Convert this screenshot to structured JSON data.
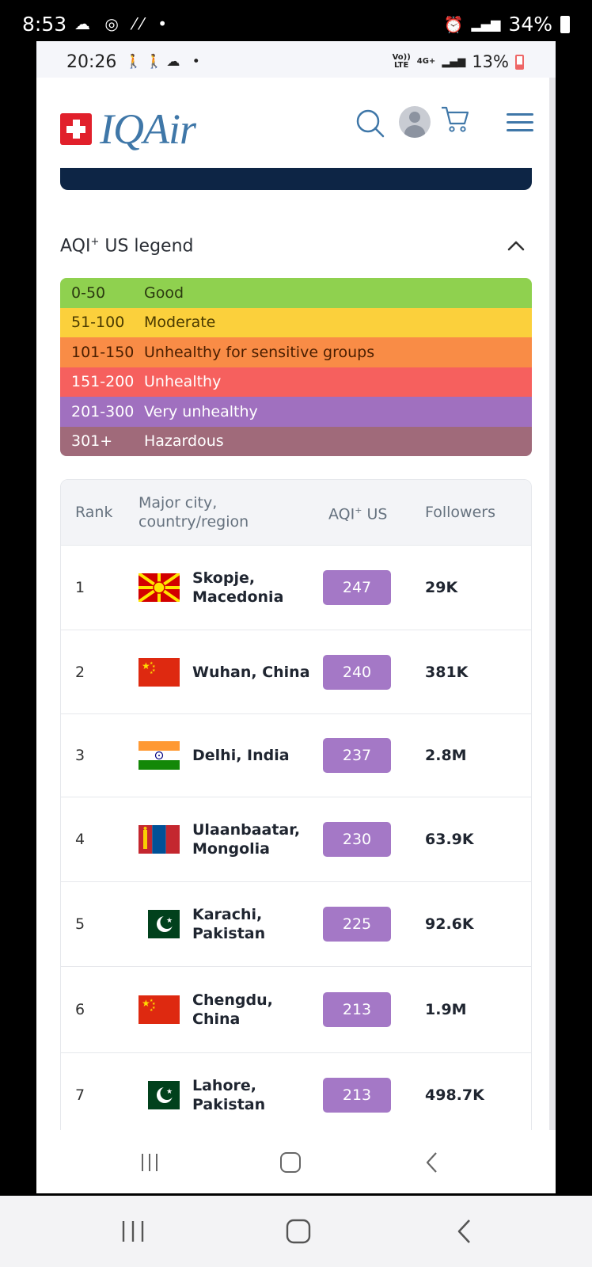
{
  "outer_status": {
    "time": "8:53",
    "battery": "34%"
  },
  "inner_status": {
    "time": "20:26",
    "net_line1": "Vo))",
    "net_line2": "LTE",
    "net_type": "4G+",
    "battery": "13%"
  },
  "header": {
    "logo_text": "IQAir"
  },
  "legend": {
    "title": "AQI",
    "title_sup": "+",
    "title_rest": " US legend",
    "rows": [
      {
        "range": "0-50",
        "label": "Good",
        "bg": "#8fd14f",
        "fg": "#2b3a10"
      },
      {
        "range": "51-100",
        "label": "Moderate",
        "bg": "#fbd03c",
        "fg": "#4a3a00"
      },
      {
        "range": "101-150",
        "label": "Unhealthy for sensitive groups",
        "bg": "#f98c46",
        "fg": "#4a1e00"
      },
      {
        "range": "151-200",
        "label": "Unhealthy",
        "bg": "#f6605e",
        "fg": "#ffffff"
      },
      {
        "range": "201-300",
        "label": "Very unhealthy",
        "bg": "#a070bf",
        "fg": "#ffffff"
      },
      {
        "range": "301+",
        "label": "Hazardous",
        "bg": "#a06a7a",
        "fg": "#ffffff"
      }
    ]
  },
  "table": {
    "headers": {
      "rank": "Rank",
      "city_line1": "Major city,",
      "city_line2": "country/region",
      "aqi": "AQI",
      "aqi_sup": "+",
      "aqi_rest": " US",
      "followers": "Followers"
    },
    "rows": [
      {
        "rank": "1",
        "city_line1": "Skopje,",
        "city_line2": "Macedonia",
        "flag": "macedonia-flag",
        "aqi": "247",
        "followers": "29K"
      },
      {
        "rank": "2",
        "city_line1": "Wuhan, China",
        "city_line2": "",
        "flag": "china-flag",
        "aqi": "240",
        "followers": "381K"
      },
      {
        "rank": "3",
        "city_line1": "Delhi, India",
        "city_line2": "",
        "flag": "india-flag",
        "aqi": "237",
        "followers": "2.8M"
      },
      {
        "rank": "4",
        "city_line1": "Ulaanbaatar,",
        "city_line2": "Mongolia",
        "flag": "mongolia-flag",
        "aqi": "230",
        "followers": "63.9K"
      },
      {
        "rank": "5",
        "city_line1": "Karachi,",
        "city_line2": "Pakistan",
        "flag": "pakistan-flag",
        "aqi": "225",
        "followers": "92.6K"
      },
      {
        "rank": "6",
        "city_line1": "Chengdu,",
        "city_line2": "China",
        "flag": "china-flag",
        "aqi": "213",
        "followers": "1.9M"
      },
      {
        "rank": "7",
        "city_line1": "Lahore,",
        "city_line2": "Pakistan",
        "flag": "pakistan-flag",
        "aqi": "213",
        "followers": "498.7K"
      }
    ]
  },
  "colors": {
    "aqi_badge": "#a478c6",
    "banner": "#0d2545",
    "brand": "#3f77a8"
  },
  "icons": [
    "search-icon",
    "avatar-icon",
    "cart-icon",
    "menu-icon",
    "chevron-up-icon",
    "recents-icon",
    "home-icon",
    "back-icon"
  ]
}
